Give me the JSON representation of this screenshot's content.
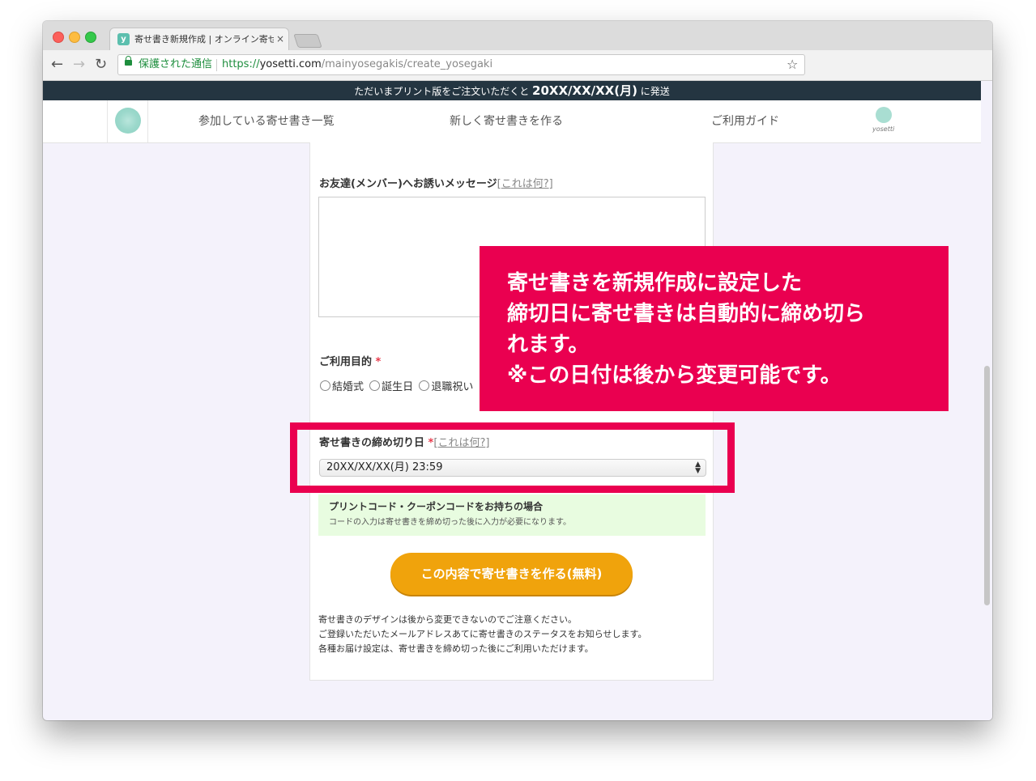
{
  "browser": {
    "tab_title": "寄せ書き新規作成 | オンライン寄せ書き",
    "favicon_letter": "y",
    "tab_close": "×",
    "back_icon": "←",
    "forward_icon": "→",
    "reload_icon": "↻",
    "secure_label": "保護された通信",
    "url_scheme": "https://",
    "url_host": "yosetti.com",
    "url_path": "/mainyosegakis/create_yosegaki",
    "bookmark_icon": "☆"
  },
  "banner": {
    "prefix": "ただいまプリント版をご注文いただくと",
    "date": "20XX/XX/XX(月)",
    "suffix": "に発送"
  },
  "nav": {
    "items": [
      "参加している寄せ書き一覧",
      "新しく寄せ書きを作る",
      "ご利用ガイド"
    ],
    "brand_text": "yosetti"
  },
  "form": {
    "invite_label": "お友達(メンバー)へお誘いメッセージ",
    "invite_help": "これは何?",
    "bracket_open": "[",
    "bracket_close": "]",
    "purpose_label": "ご利用目的",
    "required_mark": "*",
    "purpose_options": [
      "結婚式",
      "誕生日",
      "退職祝い"
    ],
    "deadline_label": "寄せ書きの締め切り日",
    "deadline_help": "これは何?",
    "deadline_value": "20XX/XX/XX(月) 23:59",
    "coupon_title": "プリントコード・クーポンコードをお持ちの場合",
    "coupon_note": "コードの入力は寄せ書きを締め切った後に入力が必要になります。",
    "submit_label": "この内容で寄せ書きを作る(無料)",
    "notes": [
      "寄せ書きのデザインは後から変更できないのでご注意ください。",
      "ご登録いただいたメールアドレスあてに寄せ書きのステータスをお知らせします。",
      "各種お届け設定は、寄せ書きを締め切った後にご利用いただけます。"
    ]
  },
  "callout": {
    "lines": [
      "寄せ書きを新規作成に設定した",
      "締切日に寄せ書きは自動的に締め切ら",
      "れます。",
      "※この日付は後から変更可能です。"
    ]
  },
  "colors": {
    "accent": "#ea0050",
    "banner_bg": "#243541",
    "cta": "#f0a30c",
    "coupon_bg": "#e8fce0"
  }
}
